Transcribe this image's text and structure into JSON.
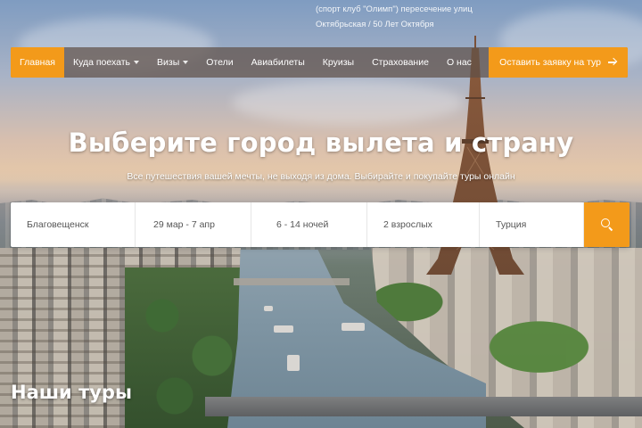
{
  "header": {
    "address_line1": "(спорт клуб \"Олимп\") пересечение улиц",
    "address_line2": "Октябрьская / 50 Лет Октября"
  },
  "nav": {
    "items": [
      {
        "label": "Главная",
        "active": true,
        "dropdown": false
      },
      {
        "label": "Куда поехать",
        "active": false,
        "dropdown": true
      },
      {
        "label": "Визы",
        "active": false,
        "dropdown": true
      },
      {
        "label": "Отели",
        "active": false,
        "dropdown": false
      },
      {
        "label": "Авиабилеты",
        "active": false,
        "dropdown": false
      },
      {
        "label": "Круизы",
        "active": false,
        "dropdown": false
      },
      {
        "label": "Страхование",
        "active": false,
        "dropdown": false
      },
      {
        "label": "О нас",
        "active": false,
        "dropdown": false
      }
    ],
    "cta_label": "Оставить заявку на тур",
    "cta_icon": "arrow-right-icon"
  },
  "hero": {
    "title": "Выберите город вылета и страну",
    "subtitle": "Все путешествия вашей мечты, не выходя из дома. Выбирайте и покупайте туры онлайн"
  },
  "search": {
    "departure_city": "Благовещенск",
    "dates": "29 мар - 7 апр",
    "nights": "6 - 14 ночей",
    "travelers": "2 взрослых",
    "country": "Турция",
    "button_icon": "search-icon"
  },
  "section": {
    "title": "Наши туры"
  },
  "colors": {
    "accent": "#f39a1a",
    "nav_bg": "#5f5048",
    "text_light": "#ffffff",
    "field_text": "#555555"
  }
}
